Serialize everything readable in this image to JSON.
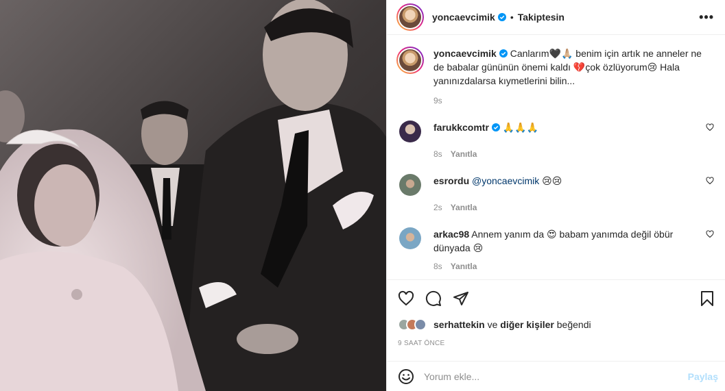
{
  "post": {
    "username": "yoncaevcimik",
    "follow_status": "Takiptesin",
    "more_label": "•••",
    "dot": "•"
  },
  "caption": {
    "username": "yoncaevcimik",
    "text": " Canlarım🖤🙏🏼 benim için artık ne anneler ne de babalar gününün önemi kaldı 💔çok özlüyorum😢 Hala yanınızdalarsa kıymetlerini bilin...",
    "age": "9s"
  },
  "comments": [
    {
      "username": "farukkcomtr",
      "verified": true,
      "text": " 🙏🙏🙏",
      "mention": "",
      "age": "8s",
      "reply": "Yanıtla",
      "avatar_color": "#5a4a6a"
    },
    {
      "username": "esrordu",
      "verified": false,
      "mention": "@yoncaevcimik",
      "text": " 😢😢",
      "age": "2s",
      "reply": "Yanıtla",
      "avatar_color": "#7a8a7a"
    },
    {
      "username": "arkac98",
      "verified": false,
      "text": " Annem yanım da 😍 babam yanımda değil öbür dünyada 😢",
      "mention": "",
      "age": "8s",
      "reply": "Yanıtla",
      "avatar_color": "#8ab0c8"
    }
  ],
  "likes": {
    "user": "serhattekin",
    "connector": " ve ",
    "others": "diğer kişiler",
    "suffix": " beğendi"
  },
  "timestamp": "9 SAAT ÖNCE",
  "add_comment": {
    "placeholder": "Yorum ekle...",
    "post_label": "Paylaş"
  },
  "colors": {
    "verified": "#0095f6",
    "link": "#00376b",
    "muted": "#8e8e8e",
    "post_disabled": "#b2dffc"
  },
  "icons": [
    "heart-icon",
    "comment-icon",
    "share-icon",
    "bookmark-icon",
    "emoji-icon",
    "verified-icon",
    "more-icon"
  ]
}
